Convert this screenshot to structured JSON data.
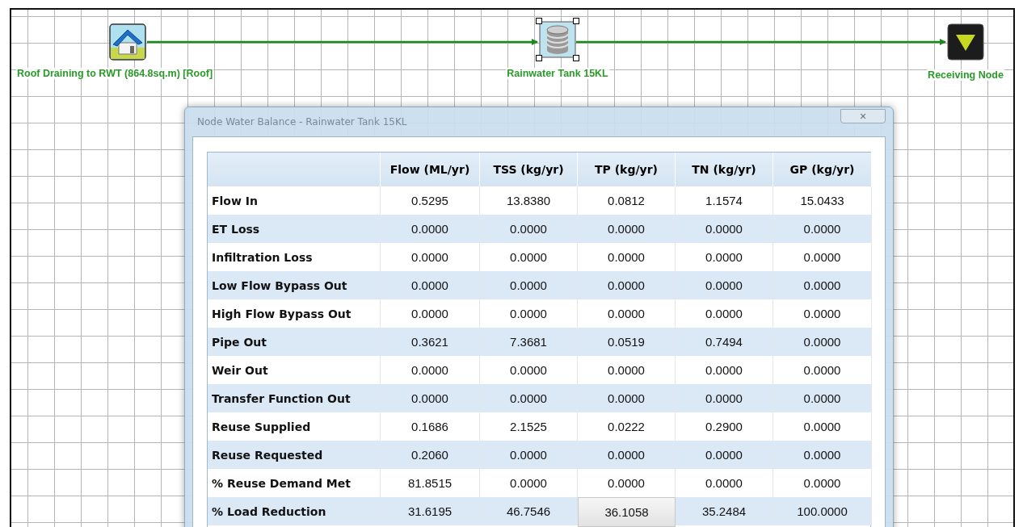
{
  "canvas": {
    "nodes": [
      {
        "kind": "roof",
        "label": "Roof Draining to RWT (864.8sq.m) [Roof]",
        "selected": false
      },
      {
        "kind": "tank",
        "label": "Rainwater Tank 15KL",
        "selected": true
      },
      {
        "kind": "receiving",
        "label": "Receiving Node",
        "selected": false
      }
    ]
  },
  "dialog": {
    "title": "Node Water Balance - Rainwater Tank 15KL",
    "close": "×",
    "table": {
      "columns": [
        "Flow (ML/yr)",
        "TSS (kg/yr)",
        "TP (kg/yr)",
        "TN (kg/yr)",
        "GP (kg/yr)"
      ],
      "rows": [
        {
          "label": "Flow In",
          "cells": [
            {
              "value": "0.5295",
              "selected": false
            },
            {
              "value": "13.8380",
              "selected": false
            },
            {
              "value": "0.0812",
              "selected": false
            },
            {
              "value": "1.1574",
              "selected": false
            },
            {
              "value": "15.0433",
              "selected": false
            }
          ]
        },
        {
          "label": "ET Loss",
          "cells": [
            {
              "value": "0.0000",
              "selected": false
            },
            {
              "value": "0.0000",
              "selected": false
            },
            {
              "value": "0.0000",
              "selected": false
            },
            {
              "value": "0.0000",
              "selected": false
            },
            {
              "value": "0.0000",
              "selected": false
            }
          ]
        },
        {
          "label": "Infiltration Loss",
          "cells": [
            {
              "value": "0.0000",
              "selected": false
            },
            {
              "value": "0.0000",
              "selected": false
            },
            {
              "value": "0.0000",
              "selected": false
            },
            {
              "value": "0.0000",
              "selected": false
            },
            {
              "value": "0.0000",
              "selected": false
            }
          ]
        },
        {
          "label": "Low Flow Bypass Out",
          "cells": [
            {
              "value": "0.0000",
              "selected": false
            },
            {
              "value": "0.0000",
              "selected": false
            },
            {
              "value": "0.0000",
              "selected": false
            },
            {
              "value": "0.0000",
              "selected": false
            },
            {
              "value": "0.0000",
              "selected": false
            }
          ]
        },
        {
          "label": "High Flow Bypass Out",
          "cells": [
            {
              "value": "0.0000",
              "selected": false
            },
            {
              "value": "0.0000",
              "selected": false
            },
            {
              "value": "0.0000",
              "selected": false
            },
            {
              "value": "0.0000",
              "selected": false
            },
            {
              "value": "0.0000",
              "selected": false
            }
          ]
        },
        {
          "label": "Pipe Out",
          "cells": [
            {
              "value": "0.3621",
              "selected": false
            },
            {
              "value": "7.3681",
              "selected": false
            },
            {
              "value": "0.0519",
              "selected": false
            },
            {
              "value": "0.7494",
              "selected": false
            },
            {
              "value": "0.0000",
              "selected": false
            }
          ]
        },
        {
          "label": "Weir Out",
          "cells": [
            {
              "value": "0.0000",
              "selected": false
            },
            {
              "value": "0.0000",
              "selected": false
            },
            {
              "value": "0.0000",
              "selected": false
            },
            {
              "value": "0.0000",
              "selected": false
            },
            {
              "value": "0.0000",
              "selected": false
            }
          ]
        },
        {
          "label": "Transfer Function Out",
          "cells": [
            {
              "value": "0.0000",
              "selected": false
            },
            {
              "value": "0.0000",
              "selected": false
            },
            {
              "value": "0.0000",
              "selected": false
            },
            {
              "value": "0.0000",
              "selected": false
            },
            {
              "value": "0.0000",
              "selected": false
            }
          ]
        },
        {
          "label": "Reuse Supplied",
          "cells": [
            {
              "value": "0.1686",
              "selected": false
            },
            {
              "value": "2.1525",
              "selected": false
            },
            {
              "value": "0.0222",
              "selected": false
            },
            {
              "value": "0.2900",
              "selected": false
            },
            {
              "value": "0.0000",
              "selected": false
            }
          ]
        },
        {
          "label": "Reuse Requested",
          "cells": [
            {
              "value": "0.2060",
              "selected": false
            },
            {
              "value": "0.0000",
              "selected": false
            },
            {
              "value": "0.0000",
              "selected": false
            },
            {
              "value": "0.0000",
              "selected": false
            },
            {
              "value": "0.0000",
              "selected": false
            }
          ]
        },
        {
          "label": "% Reuse Demand Met",
          "cells": [
            {
              "value": "81.8515",
              "selected": false
            },
            {
              "value": "0.0000",
              "selected": false
            },
            {
              "value": "0.0000",
              "selected": false
            },
            {
              "value": "0.0000",
              "selected": false
            },
            {
              "value": "0.0000",
              "selected": false
            }
          ]
        },
        {
          "label": "% Load Reduction",
          "cells": [
            {
              "value": "31.6195",
              "selected": false
            },
            {
              "value": "46.7546",
              "selected": false
            },
            {
              "value": "36.1058",
              "selected": true
            },
            {
              "value": "35.2484",
              "selected": false
            },
            {
              "value": "100.0000",
              "selected": false
            }
          ]
        }
      ]
    }
  }
}
